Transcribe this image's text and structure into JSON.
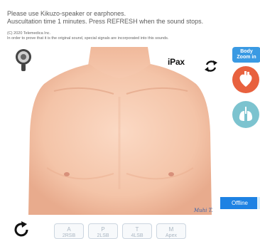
{
  "instructions": {
    "line1": "Please use Kikuzo-speaker or earphones.",
    "line2": "Auscultation time 1 minutes. Press REFRESH when the sound stops."
  },
  "copyright": {
    "line1": "(C) 2020 Telemedica Inc.",
    "line2": "In order to prove that it is the original sound, special signals are incorporated into this sounds."
  },
  "brand": {
    "ipax": "iPax",
    "signature": "Muhi T."
  },
  "controls": {
    "zoom_line1": "Body",
    "zoom_line2": "Zoom in",
    "offline": "Offline"
  },
  "points": [
    {
      "letter": "A",
      "site": "2RSB"
    },
    {
      "letter": "P",
      "site": "2LSB"
    },
    {
      "letter": "T",
      "site": "4LSB"
    },
    {
      "letter": "M",
      "site": "Apex"
    }
  ],
  "colors": {
    "accent_blue": "#1e82e3",
    "heart_btn": "#e8613e",
    "lung_btn": "#7cc3cf"
  },
  "icons": [
    "stethoscope-icon",
    "reload-icon",
    "heart-icon",
    "lungs-icon",
    "refresh-icon"
  ]
}
